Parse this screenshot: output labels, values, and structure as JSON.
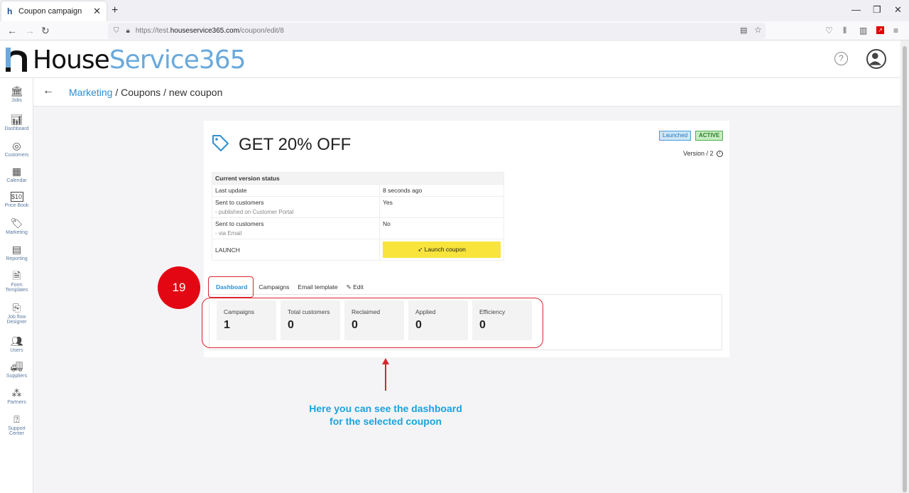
{
  "browser": {
    "tab_title": "Coupon campaign",
    "url_prefix": "https://test.",
    "url_host": "houseservice365.com",
    "url_path": "/coupon/edit/8"
  },
  "app": {
    "logo_part1": "House",
    "logo_part2": "Service365",
    "brand_color": "#6aa9dc"
  },
  "sidebar": {
    "items": [
      {
        "label": "Jobs",
        "icon": "bank-icon"
      },
      {
        "label": "Dashboard",
        "icon": "chart-icon"
      },
      {
        "label": "Customers",
        "icon": "target-icon"
      },
      {
        "label": "Calendar",
        "icon": "calendar-icon"
      },
      {
        "label": "Price Book",
        "icon": "price-tag-icon"
      },
      {
        "label": "Marketing",
        "icon": "tag-icon"
      },
      {
        "label": "Reporting",
        "icon": "calculator-icon"
      },
      {
        "label": "Form Templates",
        "icon": "form-icon"
      },
      {
        "label": "Job flow Designer",
        "icon": "flow-icon"
      },
      {
        "label": "Users",
        "icon": "users-icon"
      },
      {
        "label": "Suppliers",
        "icon": "truck-icon"
      },
      {
        "label": "Partners",
        "icon": "partners-icon"
      },
      {
        "label": "Support Center",
        "icon": "question-icon"
      }
    ]
  },
  "breadcrumb": {
    "link": "Marketing",
    "rest": " / Coupons / new coupon"
  },
  "coupon": {
    "title": "GET 20% OFF",
    "badge_launched": "Launched",
    "badge_active": "ACTIVE",
    "version": "Version / 2"
  },
  "status_table": {
    "header": "Current version status",
    "last_update_label": "Last update",
    "last_update_value": "8 seconds ago",
    "sent_portal_label": "Sent to customers",
    "sent_portal_sub": "- published on Customer Portal",
    "sent_portal_value": "Yes",
    "sent_email_label": "Sent to customers",
    "sent_email_sub": "- via Email",
    "sent_email_value": "No",
    "launch_label": "LAUNCH",
    "launch_button": "Launch coupon"
  },
  "tabs": {
    "dashboard": "Dashboard",
    "campaigns": "Campaigns",
    "email_template": "Email template",
    "edit": "Edit"
  },
  "metrics": [
    {
      "label": "Campaigns",
      "value": "1"
    },
    {
      "label": "Total customers",
      "value": "0"
    },
    {
      "label": "Reclaimed",
      "value": "0"
    },
    {
      "label": "Applied",
      "value": "0"
    },
    {
      "label": "Efficiency",
      "value": "0"
    }
  ],
  "annotation": {
    "step": "19",
    "caption": "Here you can see the dashboard for the selected coupon"
  }
}
